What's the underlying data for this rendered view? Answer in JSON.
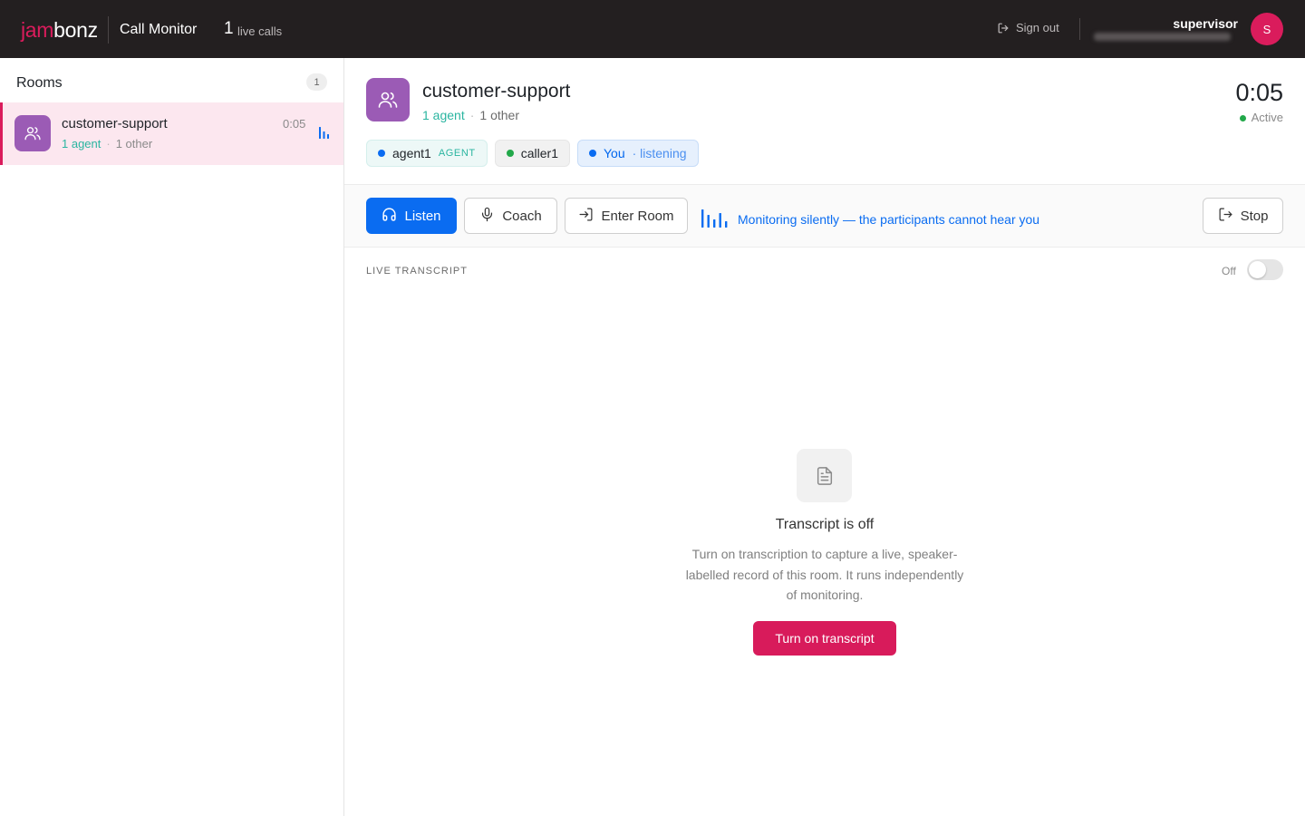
{
  "topbar": {
    "brand_part1": "jam",
    "brand_part2": "bonz",
    "app_title": "Call Monitor",
    "live_count": "1",
    "live_label": "live calls",
    "signout_label": "Sign out",
    "user_name": "supervisor",
    "avatar_initial": "S"
  },
  "sidebar": {
    "title": "Rooms",
    "count": "1",
    "rooms": [
      {
        "name": "customer-support",
        "agents": "1 agent",
        "sep": "·",
        "others": "1 other",
        "duration": "0:05"
      }
    ]
  },
  "room": {
    "name": "customer-support",
    "agents": "1 agent",
    "sep": "·",
    "others": "1 other",
    "timer": "0:05",
    "status": "Active",
    "participants": [
      {
        "name": "agent1",
        "role": "AGENT",
        "dot_color": "#0a6cf1"
      },
      {
        "name": "caller1",
        "dot_color": "#22a84a"
      },
      {
        "name": "You",
        "status": "· listening",
        "dot_color": "#0a6cf1"
      }
    ]
  },
  "controls": {
    "listen_label": "Listen",
    "coach_label": "Coach",
    "enter_label": "Enter Room",
    "monitor_note": "Monitoring silently — the participants cannot hear you",
    "stop_label": "Stop"
  },
  "transcript": {
    "section_label": "LIVE TRANSCRIPT",
    "toggle_label": "Off",
    "toggle_on": false,
    "empty_title": "Transcript is off",
    "empty_body": "Turn on transcription to capture a live, speaker-labelled record of this room. It runs independently of monitoring.",
    "cta_label": "Turn on transcript"
  },
  "colors": {
    "brand": "#da1c5c",
    "primary": "#0a6cf1",
    "room_icon": "#9b5bb5",
    "agent": "#2ab5a0",
    "active": "#22a84a"
  },
  "icons": [
    "people-icon",
    "sound-bars-icon",
    "headphones-icon",
    "microphone-icon",
    "enter-icon",
    "exit-icon",
    "document-icon",
    "signout-icon"
  ]
}
